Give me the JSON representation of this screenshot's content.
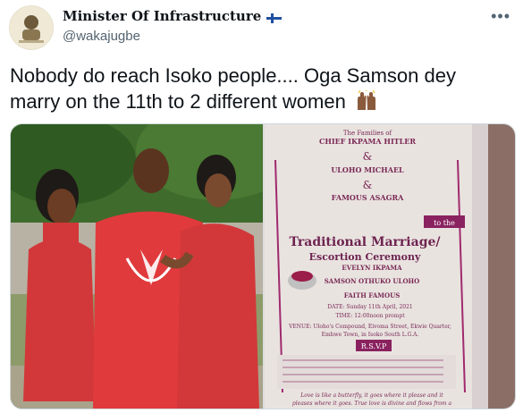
{
  "tweet": {
    "display_name": "Minister Of Infrastructure",
    "handle": "@wakajugbe",
    "text": "Nobody do reach Isoko people.... Oga Samson dey marry on the 11th to 2 different women",
    "flag_icon": "finland-flag-icon",
    "emoji_icon": "raising-hands-icon"
  },
  "media": {
    "left_photo_alt_icon": "couple-photo",
    "invitation": {
      "families_header": "The Families of",
      "family1": "CHIEF IKPAMA HITLER",
      "and1": "&",
      "family2": "ULOHO MICHAEL",
      "and2": "&",
      "family3": "FAMOUS ASAGRA",
      "to_the": "to the",
      "event_title": "Traditional Marriage/",
      "event_subtitle": "Escortion Ceremony",
      "bride1": "EVELYN IKPAMA",
      "groom": "SAMSON OTHUKO ULOHO",
      "bride2": "FAITH FAMOUS",
      "date": "DATE: Sunday 11th April, 2021",
      "time": "TIME: 12:00noon prompt",
      "venue": "VENUE: Uloho's Compound, Eivoma Street, Ekwie Quarter,",
      "venue2": "Emhwe Town, in Isoko South L.G.A.",
      "rsvp": "R.S.V.P",
      "quote": "Love is like a butterfly, it goes where it please and it",
      "quote2": "pleases where it goes. True love is divine and flows from a"
    }
  }
}
